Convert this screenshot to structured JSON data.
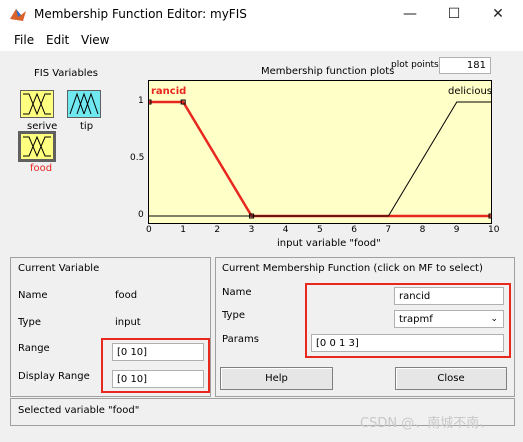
{
  "window": {
    "title": "Membership Function Editor: myFIS",
    "minimize": "—",
    "maximize": "☐",
    "close": "✕"
  },
  "menu": [
    "File",
    "Edit",
    "View"
  ],
  "fis_vars": {
    "title": "FIS Variables",
    "items": [
      {
        "label": "serive",
        "color": "#ffff80"
      },
      {
        "label": "tip",
        "color": "#70e8f0"
      },
      {
        "label": "food",
        "color": "#ffff80",
        "selected": true
      }
    ]
  },
  "plot": {
    "title": "Membership function plots",
    "plot_points_label": "plot points:",
    "plot_points_value": "181",
    "xlabel": "input variable \"food\"",
    "x_ticks": [
      "0",
      "1",
      "2",
      "3",
      "4",
      "5",
      "6",
      "7",
      "8",
      "9",
      "10"
    ],
    "y_ticks": [
      "1",
      "0.5",
      "0"
    ],
    "mf_labels": {
      "left": "rancid",
      "right": "delicious"
    }
  },
  "chart_data": {
    "type": "line",
    "xlim": [
      0,
      10
    ],
    "ylim": [
      0,
      1
    ],
    "series": [
      {
        "name": "rancid",
        "x": [
          0,
          1,
          3,
          10
        ],
        "y": [
          1,
          1,
          0,
          0
        ],
        "color": "#e8271f"
      },
      {
        "name": "delicious",
        "x": [
          0,
          7,
          9,
          10
        ],
        "y": [
          0,
          0,
          1,
          1
        ],
        "color": "#000000"
      }
    ]
  },
  "current_variable": {
    "title": "Current Variable",
    "name_label": "Name",
    "name_value": "food",
    "type_label": "Type",
    "type_value": "input",
    "range_label": "Range",
    "range_value": "[0 10]",
    "display_range_label": "Display Range",
    "display_range_value": "[0 10]"
  },
  "current_mf": {
    "title": "Current Membership Function (click on MF to select)",
    "name_label": "Name",
    "name_value": "rancid",
    "type_label": "Type",
    "type_value": "trapmf",
    "params_label": "Params",
    "params_value": "[0 0 1 3]"
  },
  "buttons": {
    "help": "Help",
    "close": "Close"
  },
  "status": "Selected variable \"food\"",
  "watermark": "CSDN @、南城不南、"
}
